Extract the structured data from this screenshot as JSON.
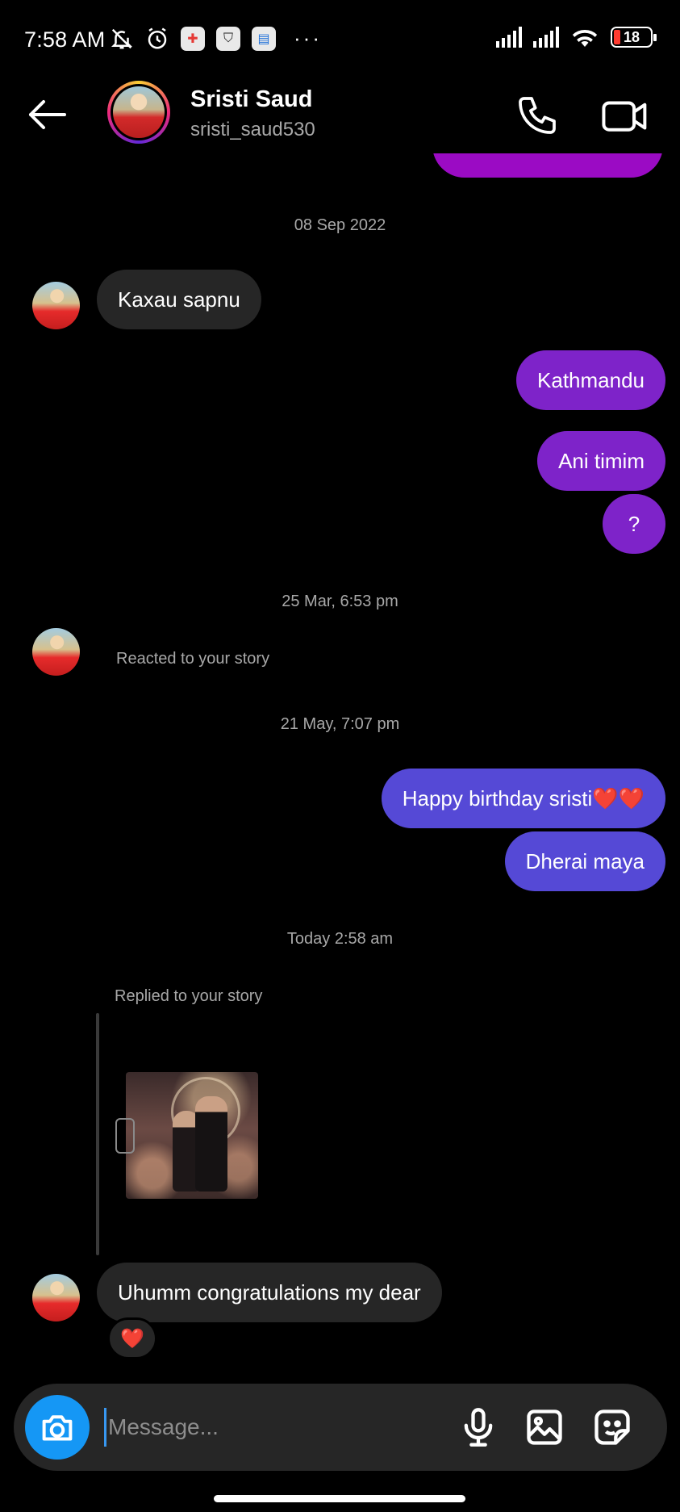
{
  "status_bar": {
    "time": "7:58 AM",
    "battery_level": "18",
    "icons": [
      "bell-off-icon",
      "alarm-icon",
      "app-badge-icon",
      "shield-icon",
      "app-badge-icon",
      "more-dots-icon",
      "signal-icon",
      "signal-icon",
      "wifi-icon",
      "battery-icon"
    ],
    "more": "···"
  },
  "header": {
    "contact_name": "Sristi Saud",
    "username": "sristi_saud530"
  },
  "messages": {
    "ts1": "08 Sep 2022",
    "m1": "Kaxau sapnu",
    "m2": "Kathmandu",
    "m3": "Ani timim",
    "m4": "?",
    "ts2": "25 Mar, 6:53 pm",
    "reacted": "Reacted to your story",
    "ts3": "21 May, 7:07 pm",
    "m5": "Happy birthday sristi❤️❤️",
    "m6": "Dherai maya",
    "ts4": "Today 2:58 am",
    "replied": "Replied to your story",
    "m7": "Uhumm congratulations my dear",
    "reaction": "❤️"
  },
  "composer": {
    "placeholder": "Message..."
  },
  "colors": {
    "outgoing_purple": "#7e23c9",
    "outgoing_blue": "#5549d6",
    "incoming": "#262626",
    "camera": "#1597f5"
  }
}
